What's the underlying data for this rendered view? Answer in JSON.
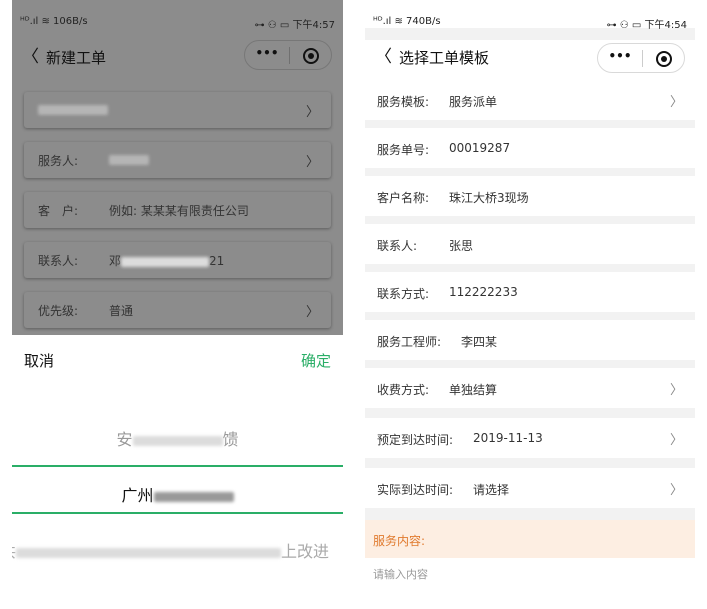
{
  "left": {
    "status": {
      "signal": "ᴴᴰ.ıl ≋ 106B/s",
      "right": "⊶ ⚇ ▭ 下午4:57"
    },
    "nav": {
      "back": "〈",
      "title": "新建工单",
      "dots": "•••"
    },
    "rows": [
      {
        "label": "",
        "value": "",
        "chevron": "〉"
      },
      {
        "label": "服务人:",
        "value": "",
        "chevron": "〉"
      },
      {
        "label": "客　户:",
        "value": "例如: 某某某有限责任公司",
        "chevron": ""
      },
      {
        "label": "联系人:",
        "value": "邓",
        "value_tail": "21",
        "chevron": ""
      },
      {
        "label": "优先级:",
        "value": "普通",
        "chevron": "〉"
      }
    ],
    "picker": {
      "cancel": "取消",
      "confirm": "确定",
      "options": [
        {
          "head": "安",
          "tail": "馈"
        },
        {
          "head": "广州",
          "tail": ""
        },
        {
          "head": "共",
          "tail": "上改进"
        }
      ]
    }
  },
  "right": {
    "status": {
      "signal": "ᴴᴰ.ıl ≋ 740B/s",
      "right": "⊶ ⚇ ▭ 下午4:54"
    },
    "nav": {
      "back": "〈",
      "title": "选择工单模板",
      "dots": "•••"
    },
    "rows": [
      {
        "label": "服务模板:",
        "value": "服务派单",
        "chevron": "〉"
      },
      {
        "label": "服务单号:",
        "value": "00019287",
        "chevron": ""
      },
      {
        "label": "客户名称:",
        "value": "珠江大桥3现场",
        "chevron": ""
      },
      {
        "label": "联系人:",
        "value": "张思",
        "chevron": ""
      },
      {
        "label": "联系方式:",
        "value": "112222233",
        "chevron": ""
      },
      {
        "label": "服务工程师:",
        "value": "李四某",
        "chevron": ""
      },
      {
        "label": "收费方式:",
        "value": "单独结算",
        "chevron": "〉"
      },
      {
        "label": "预定到达时间:",
        "value": "2019-11-13",
        "chevron": "〉"
      },
      {
        "label": "实际到达时间:",
        "value": "请选择",
        "chevron": "〉"
      }
    ],
    "service_content": {
      "label": "服务内容:",
      "placeholder": "请输入内容"
    }
  },
  "colors": {
    "accent_green": "#2aae67",
    "orange_text": "#e07a2e",
    "orange_bg": "#fdeee2",
    "dim_overlay": "#8c8c8c"
  }
}
